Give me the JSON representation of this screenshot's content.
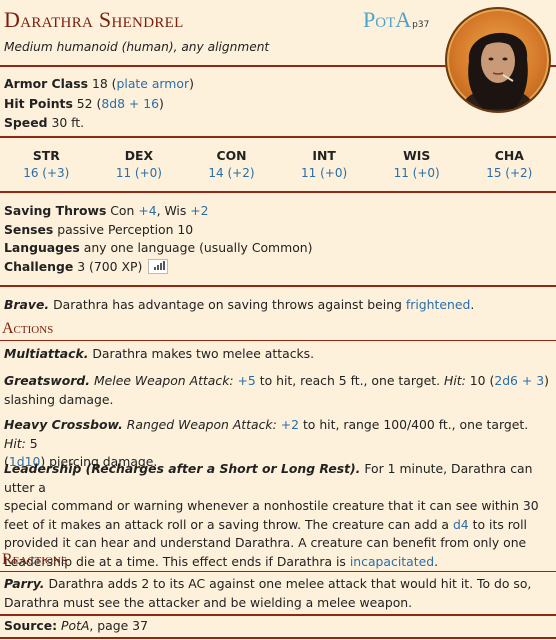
{
  "header": {
    "name": "Darathra Shendrel",
    "source_abbr": "PotA",
    "source_page": "p37",
    "subtitle": "Medium humanoid (human), any alignment"
  },
  "stats": {
    "ac_label": "Armor Class",
    "ac_value": "18",
    "ac_note": "plate armor",
    "hp_label": "Hit Points",
    "hp_value": "52",
    "hp_formula": "8d8 + 16",
    "speed_label": "Speed",
    "speed_value": "30 ft."
  },
  "abilities": [
    {
      "name": "STR",
      "value": "16 (+3)"
    },
    {
      "name": "DEX",
      "value": "11 (+0)"
    },
    {
      "name": "CON",
      "value": "14 (+2)"
    },
    {
      "name": "INT",
      "value": "11 (+0)"
    },
    {
      "name": "WIS",
      "value": "11 (+0)"
    },
    {
      "name": "CHA",
      "value": "15 (+2)"
    }
  ],
  "properties": {
    "saves_label": "Saving Throws",
    "saves_con": "+4",
    "saves_wis": "+2",
    "senses_label": "Senses",
    "senses_value": "passive Perception 10",
    "languages_label": "Languages",
    "languages_value": "any one language (usually Common)",
    "challenge_label": "Challenge",
    "challenge_value": "3 (700 XP)"
  },
  "traits": {
    "brave_title": "Brave.",
    "brave_text1": "Darathra has advantage on saving throws against being",
    "brave_link": "frightened"
  },
  "actions": {
    "heading": "Actions",
    "multi_title": "Multiattack.",
    "multi_text": "Darathra makes two melee attacks.",
    "great_title": "Greatsword.",
    "great_type": "Melee Weapon Attack:",
    "great_bonus": "+5",
    "great_text1": "to hit, reach 5 ft., one target.",
    "great_hit": "Hit:",
    "great_dmg": "10",
    "great_dice": "2d6 + 3",
    "great_text2": "slashing damage.",
    "xbow_title": "Heavy Crossbow.",
    "xbow_type": "Ranged Weapon Attack:",
    "xbow_bonus": "+2",
    "xbow_text1": "to hit, range 100/400 ft., one target.",
    "xbow_hit": "Hit:",
    "xbow_dmg": "5",
    "xbow_dice": "1d10",
    "xbow_text2": "piercing damage.",
    "lead_title": "Leadership (Recharges after a Short or Long Rest).",
    "lead_line1": "For 1 minute, Darathra can utter a",
    "lead_line2": "special command or warning whenever a nonhostile creature that it can see within 30",
    "lead_line3": "feet of it makes an attack roll or a saving throw. The creature can add a",
    "lead_die": "d4",
    "lead_line3b": "to its roll",
    "lead_line4": "provided it can hear and understand Darathra. A creature can benefit from only one",
    "lead_line5": "Leadership die at a time. This effect ends if Darathra is",
    "lead_link": "incapacitated"
  },
  "reactions": {
    "heading": "Reactions",
    "parry_title": "Parry.",
    "parry_line1": "Darathra adds 2 to its AC against one melee attack that would hit it. To do so,",
    "parry_line2": "Darathra must see the attacker and be wielding a melee weapon."
  },
  "footer": {
    "label": "Source:",
    "book": "PotA",
    "page": ", page 37"
  },
  "colors": {
    "background": "#fdf1dc",
    "rule": "#922610",
    "heading": "#7a200d",
    "link": "#2a6ea8",
    "source_abbr": "#4fa3c7"
  }
}
